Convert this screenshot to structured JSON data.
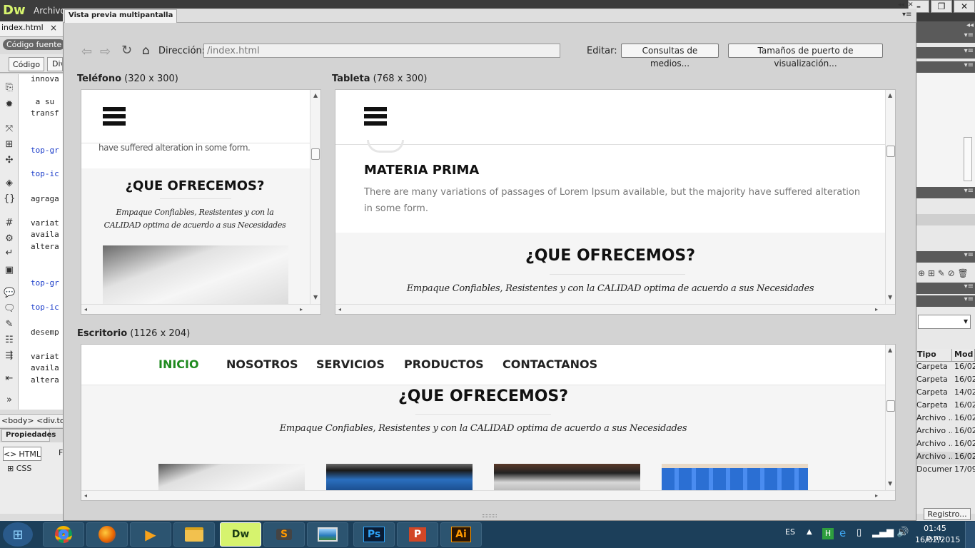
{
  "app": {
    "logo": "Dw",
    "menu_first": "Archivo",
    "document_tab": "index.html",
    "document_close": "×",
    "source_pill": "Código fuente",
    "code_button": "Código",
    "div_button": "Div",
    "status_path": "<body> <div.top-",
    "properties_tab": "Propiedades",
    "html_button": "HTML",
    "css_button": "CSS",
    "f_label": "F"
  },
  "code_lines": [
    "innova",
    " a su",
    "transf",
    "top-gr",
    "top-ic",
    "agraga",
    "variat",
    "availa",
    "altera",
    "top-gr",
    "top-ic",
    "desemp",
    "variat",
    "availa",
    "altera"
  ],
  "dialog": {
    "title": "Vista previa multipantalla",
    "address_label": "Dirección:",
    "address_value": "/index.html",
    "edit_label": "Editar:",
    "media_button": "Consultas de medios...",
    "viewport_button": "Tamaños de puerto de visualización..."
  },
  "viewports": {
    "phone": {
      "name": "Teléfono",
      "size": "(320 x 300)"
    },
    "tablet": {
      "name": "Tableta",
      "size": "(768 x 300)"
    },
    "desktop": {
      "name": "Escritorio",
      "size": "(1126 x 204)"
    }
  },
  "phone_content": {
    "partial_text": "have suffered alteration in some form.",
    "title": "¿QUE OFRECEMOS?",
    "subtitle_line1": "Empaque Confiables, Resistentes y con la",
    "subtitle_line2": "CALIDAD optima de acuerdo a sus Necesidades"
  },
  "tablet_content": {
    "heading": "MATERIA PRIMA",
    "paragraph_line1": "There are many variations of passages of Lorem Ipsum available, but the majority have suffered alteration",
    "paragraph_line2": "in some form.",
    "title": "¿QUE OFRECEMOS?",
    "subtitle": "Empaque Confiables, Resistentes y con la CALIDAD optima de acuerdo a sus Necesidades"
  },
  "desktop_content": {
    "nav": [
      "INICIO",
      "NOSOTROS",
      "SERVICIOS",
      "PRODUCTOS",
      "CONTACTANOS"
    ],
    "active_color": "#1e8a1e",
    "title": "¿QUE OFRECEMOS?",
    "subtitle": "Empaque Confiables, Resistentes y con la CALIDAD optima de acuerdo a sus Necesidades"
  },
  "files_panel": {
    "col_type": "Tipo",
    "col_mod": "Mod",
    "rows": [
      {
        "type": "Carpeta",
        "mod": "16/02"
      },
      {
        "type": "Carpeta",
        "mod": "16/02"
      },
      {
        "type": "Carpeta",
        "mod": "14/02"
      },
      {
        "type": "Carpeta",
        "mod": "16/02"
      },
      {
        "type": "Archivo ...",
        "mod": "16/02"
      },
      {
        "type": "Archivo ...",
        "mod": "16/02"
      },
      {
        "type": "Archivo ...",
        "mod": "16/02"
      },
      {
        "type": "Archivo ...",
        "mod": "16/02"
      },
      {
        "type": "Documen...",
        "mod": "17/09"
      }
    ],
    "register_button": "Registro..."
  },
  "taskbar": {
    "apps": [
      "Chrome",
      "Firefox",
      "Media",
      "Explorer",
      "Dw",
      "S",
      "Photos",
      "Ps",
      "P",
      "Ai"
    ],
    "lang": "ES",
    "time": "01:45 p.m.",
    "date": "16/02/2015"
  },
  "colors": {
    "desktop_active_nav": "#1e8a1e",
    "taskbar": "#1c3f5a"
  }
}
